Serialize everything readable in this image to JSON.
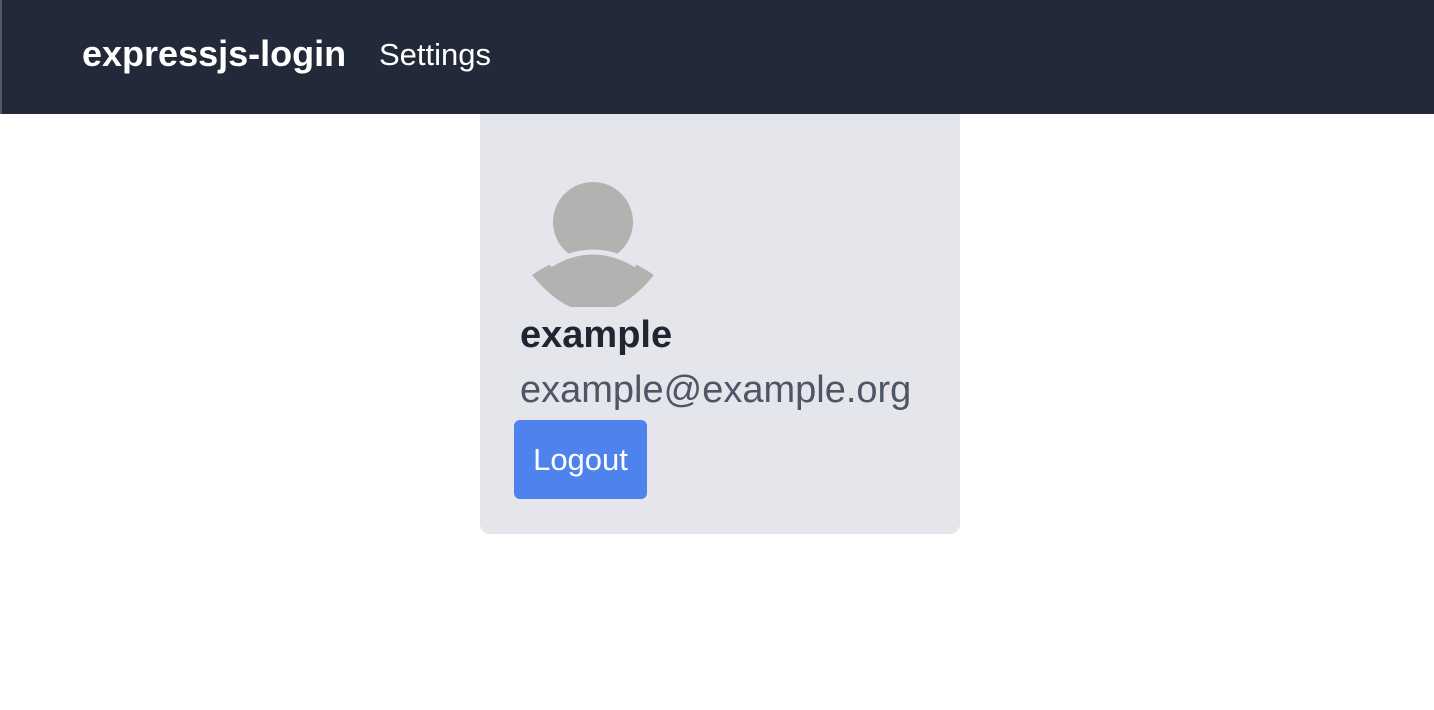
{
  "navbar": {
    "brand": "expressjs-login",
    "links": [
      {
        "label": "Settings"
      }
    ]
  },
  "profile": {
    "avatar_icon": "user-avatar-icon",
    "username": "example",
    "email": "example@example.org",
    "logout_label": "Logout"
  },
  "colors": {
    "navbar_bg": "#222938",
    "card_bg": "#e5e6eb",
    "button_bg": "#4e83ee",
    "avatar_fill": "#b3b2b1"
  }
}
